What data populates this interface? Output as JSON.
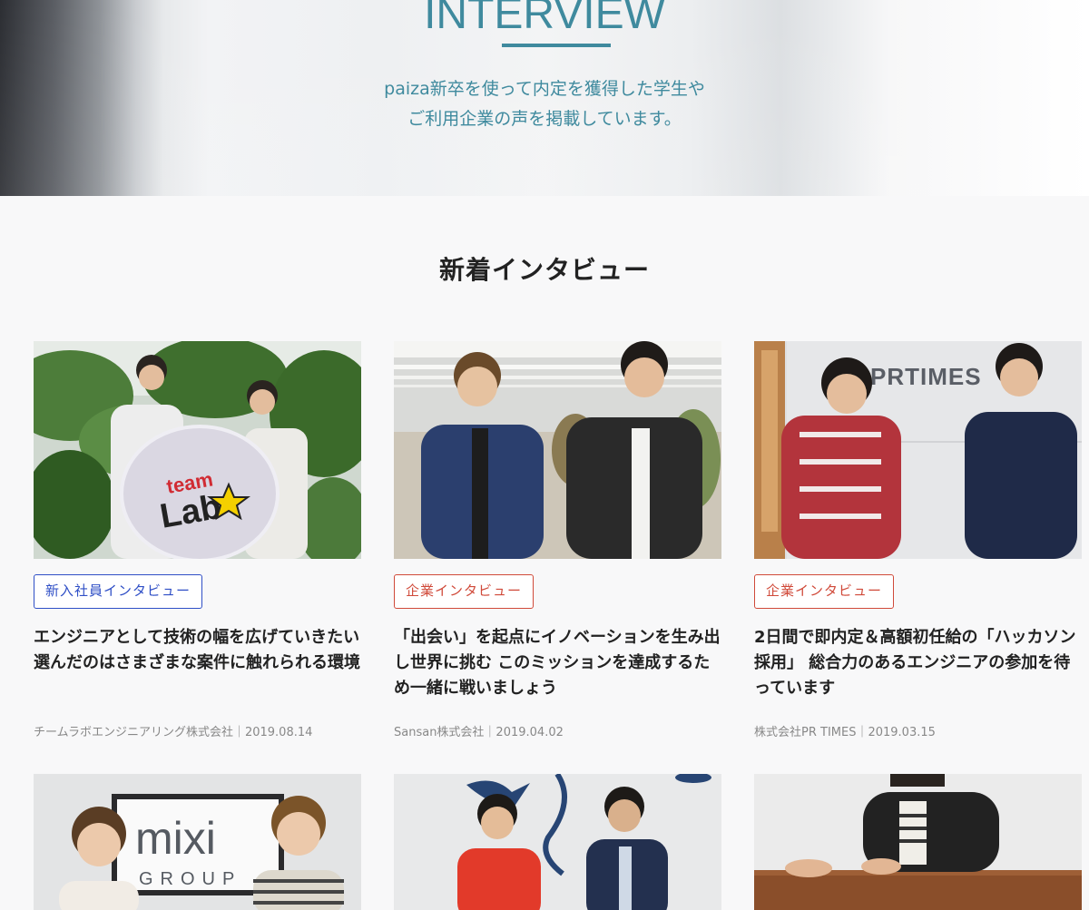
{
  "hero": {
    "title": "INTERVIEW",
    "desc_line1": "paiza新卒を使って内定を獲得した学生や",
    "desc_line2": "ご利用企業の声を掲載しています。"
  },
  "section": {
    "title": "新着インタビュー"
  },
  "cards": [
    {
      "tag": "新入社員インタビュー",
      "tag_color": "#2f4fc6",
      "title": "エンジニアとして技術の幅を広げていきたい 選んだのはさまざまな案件に触れられる環境",
      "meta": "チームラボエンジニアリング株式会社｜2019.08.14",
      "photo_sign_line1": "team",
      "photo_sign_line2": "Lab"
    },
    {
      "tag": "企業インタビュー",
      "tag_color": "#d04a3a",
      "title": "「出会い」を起点にイノベーションを生み出し世界に挑む このミッションを達成するため一緒に戦いましょう",
      "meta": "Sansan株式会社｜2019.04.02"
    },
    {
      "tag": "企業インタビュー",
      "tag_color": "#d04a3a",
      "title": "2日間で即内定＆高額初任給の「ハッカソン採用」 総合力のあるエンジニアの参加を待っています",
      "meta": "株式会社PR TIMES｜2019.03.15",
      "photo_sign": "PRTIMES"
    },
    {
      "photo_sign_line1": "mixi",
      "photo_sign_line2": "GROUP"
    },
    {},
    {}
  ]
}
